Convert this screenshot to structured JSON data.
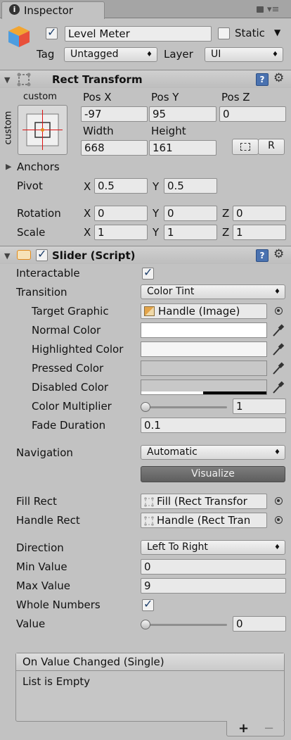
{
  "tab": {
    "title": "Inspector"
  },
  "go": {
    "name": "Level Meter",
    "static_label": "Static",
    "tag_label": "Tag",
    "tag_value": "Untagged",
    "layer_label": "Layer",
    "layer_value": "UI"
  },
  "rect": {
    "title": "Rect Transform",
    "anchor_top": "custom",
    "anchor_side": "custom",
    "pos_x_label": "Pos X",
    "pos_y_label": "Pos Y",
    "pos_z_label": "Pos Z",
    "pos_x": "-97",
    "pos_y": "95",
    "pos_z": "0",
    "width_label": "Width",
    "height_label": "Height",
    "width": "668",
    "height": "161",
    "r_label": "R",
    "anchors_label": "Anchors",
    "pivot_label": "Pivot",
    "pivot_x": "0.5",
    "pivot_y": "0.5",
    "rotation_label": "Rotation",
    "rot_x": "0",
    "rot_y": "0",
    "rot_z": "0",
    "scale_label": "Scale",
    "scale_x": "1",
    "scale_y": "1",
    "scale_z": "1",
    "x": "X",
    "y": "Y",
    "z": "Z"
  },
  "slider": {
    "title": "Slider (Script)",
    "interactable_label": "Interactable",
    "transition_label": "Transition",
    "transition_value": "Color Tint",
    "target_graphic_label": "Target Graphic",
    "target_graphic_value": "Handle (Image)",
    "normal_color_label": "Normal Color",
    "highlighted_color_label": "Highlighted Color",
    "pressed_color_label": "Pressed Color",
    "disabled_color_label": "Disabled Color",
    "color_multiplier_label": "Color Multiplier",
    "color_multiplier_value": "1",
    "fade_duration_label": "Fade Duration",
    "fade_duration_value": "0.1",
    "navigation_label": "Navigation",
    "navigation_value": "Automatic",
    "visualize_label": "Visualize",
    "fill_rect_label": "Fill Rect",
    "fill_rect_value": "Fill (Rect Transfor",
    "handle_rect_label": "Handle Rect",
    "handle_rect_value": "Handle (Rect Tran",
    "direction_label": "Direction",
    "direction_value": "Left To Right",
    "min_value_label": "Min Value",
    "min_value": "0",
    "max_value_label": "Max Value",
    "max_value": "9",
    "whole_numbers_label": "Whole Numbers",
    "value_label": "Value",
    "value": "0",
    "event_title": "On Value Changed (Single)",
    "event_empty": "List is Empty",
    "add_label": "+",
    "remove_label": "−"
  },
  "colors": {
    "normal": "#ffffff",
    "highlighted": "#f5f5f5",
    "pressed": "#c8c8c8",
    "disabled": "#c8c8c8",
    "accent": "#4a72b0"
  },
  "icons": [
    "info-icon",
    "lock-icon",
    "menu-icon",
    "cube-icon",
    "rect-transform-icon",
    "help-icon",
    "gear-icon",
    "slider-script-icon",
    "image-object-icon",
    "object-picker-icon",
    "eyedropper-icon"
  ]
}
